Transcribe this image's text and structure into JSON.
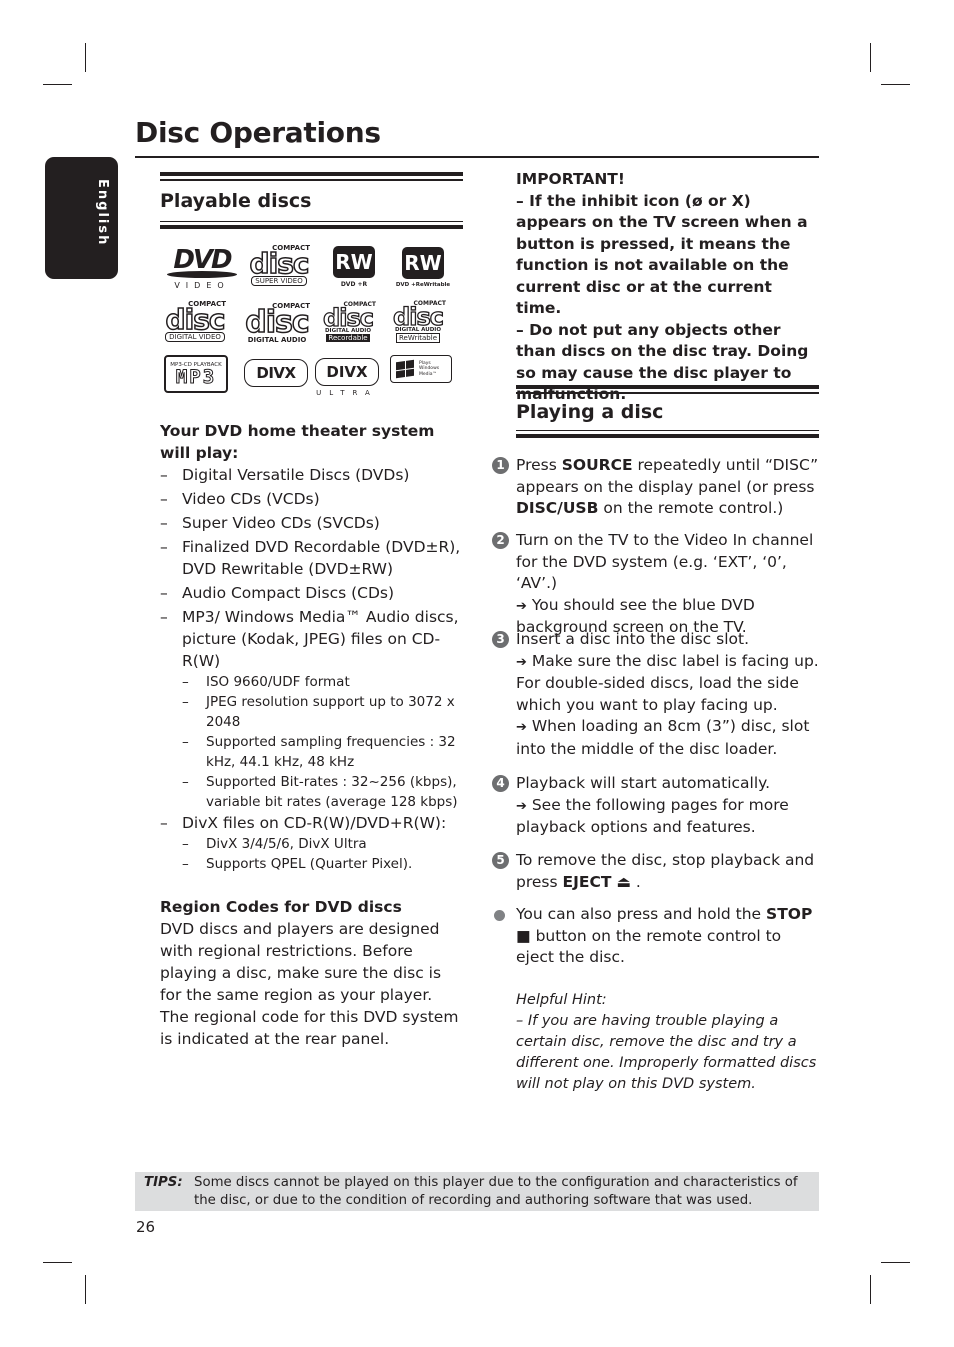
{
  "language_tab": "English",
  "page_title": "Disc Operations",
  "playable_discs": {
    "heading": "Playable discs",
    "logos": [
      {
        "name": "dvd-video-logo",
        "main": "DVD",
        "caption": "VIDEO"
      },
      {
        "name": "compact-disc-super-video-logo",
        "top": "COMPACT",
        "main": "disc",
        "caption": "SUPER VIDEO"
      },
      {
        "name": "dvd-plus-r-logo",
        "main": "RW",
        "caption": "DVD +R"
      },
      {
        "name": "dvd-plus-rewritable-logo",
        "main": "RW",
        "caption": "DVD +ReWritable"
      },
      {
        "name": "compact-disc-digital-video-logo",
        "top": "COMPACT",
        "main": "disc",
        "caption": "DIGITAL VIDEO"
      },
      {
        "name": "compact-disc-digital-audio-logo",
        "top": "COMPACT",
        "main": "disc",
        "caption": "DIGITAL AUDIO"
      },
      {
        "name": "compact-disc-recordable-logo",
        "top": "COMPACT",
        "main": "disc",
        "sub": "DIGITAL AUDIO",
        "caption": "Recordable"
      },
      {
        "name": "compact-disc-rewritable-logo",
        "top": "COMPACT",
        "main": "disc",
        "sub": "DIGITAL AUDIO",
        "caption": "ReWritable"
      },
      {
        "name": "mp3-cd-playback-logo",
        "top": "MP3-CD PLAYBACK",
        "main": "MP3"
      },
      {
        "name": "divx-logo",
        "main": "DIVX"
      },
      {
        "name": "divx-ultra-logo",
        "main": "DIVX",
        "caption": "ULTRA"
      },
      {
        "name": "windows-media-logo",
        "lines": [
          "Plays",
          "Windows",
          "Media™"
        ]
      }
    ],
    "intro": "Your DVD home theater system will play:",
    "items": [
      "Digital Versatile Discs (DVDs)",
      "Video CDs (VCDs)",
      "Super Video CDs (SVCDs)",
      "Finalized DVD Recordable (DVD±R), DVD Rewritable (DVD±RW)",
      "Audio Compact Discs (CDs)",
      "MP3/ Windows Media™ Audio discs, picture (Kodak, JPEG) files on CD-R(W)"
    ],
    "mp3_subitems": [
      "ISO 9660/UDF format",
      "JPEG resolution support up to 3072 x 2048",
      "Supported sampling frequencies : 32 kHz, 44.1 kHz, 48 kHz",
      "Supported Bit-rates : 32~256 (kbps), variable bit rates (average 128 kbps)"
    ],
    "divx_item": "DivX files on CD-R(W)/DVD+R(W):",
    "divx_subitems": [
      "DivX 3/4/5/6, DivX Ultra",
      "Supports QPEL (Quarter Pixel)."
    ],
    "region_heading": "Region Codes for DVD discs",
    "region_text": "DVD discs and players are designed with regional restrictions. Before playing a disc, make sure the disc is for the same region as your player.  The regional code for this DVD system is indicated at the rear panel."
  },
  "important": {
    "label": "IMPORTANT!",
    "p1": "– If the inhibit icon (ø or X) appears on the TV screen when a button is pressed, it means the function is not available on the current disc or at the current time.",
    "p2": "– Do not put any objects other than discs on the disc tray.  Doing so may cause the disc player to malfunction."
  },
  "playing": {
    "heading": "Playing a disc",
    "steps": [
      {
        "num": "1",
        "pre": "Press ",
        "bold1": "SOURCE",
        "mid": " repeatedly until “DISC” appears on the display panel (or press ",
        "bold2": "DISC/USB",
        "post": " on the remote control.)"
      },
      {
        "num": "2",
        "text": "Turn on the TV to the Video In channel for the DVD system (e.g. ‘EXT’, ‘0’, ‘AV’.)",
        "result": "You should see the blue DVD background screen on the TV."
      },
      {
        "num": "3",
        "text": "Insert a disc into the disc slot.",
        "result1": "Make sure the disc label is facing up. For double-sided discs, load the side which you want to play facing up.",
        "result2": "When loading an 8cm (3”) disc, slot into the middle of the disc loader."
      },
      {
        "num": "4",
        "text": "Playback will start automatically.",
        "result": "See the following pages for more playback options and features."
      },
      {
        "num": "5",
        "pre": "To remove the disc, stop playback and press ",
        "bold1": "EJECT",
        "post": " ."
      }
    ],
    "bullet": {
      "pre": "You can also press and hold the ",
      "bold": "STOP",
      "post": " button on the remote control to eject the disc."
    },
    "arrow_glyph": "➔",
    "eject_glyph": "⏏",
    "stop_glyph": "■",
    "hint_title": "Helpful Hint:",
    "hint_text": "– If you are having trouble playing a certain disc, remove the disc and try a different one. Improperly formatted discs will not play on this DVD system."
  },
  "tips": {
    "label": "TIPS:",
    "text": "Some discs cannot be played on this player due to the configuration and characteristics of the disc, or due to the condition of recording and authoring software that was used."
  },
  "page_number": "26",
  "colors": {
    "ink": "#231f20",
    "tips_bg": "#dcddde",
    "step_circle": "#6d6e70"
  }
}
